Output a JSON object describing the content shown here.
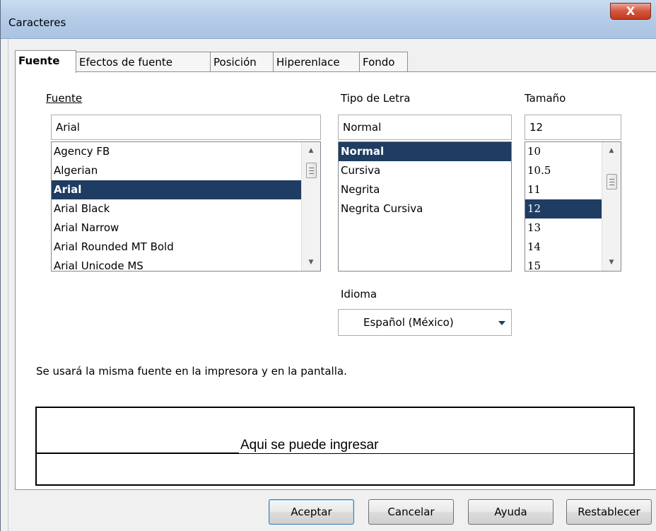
{
  "window": {
    "title": "Caracteres",
    "close_label": "X"
  },
  "tabs": [
    {
      "label": "Fuente",
      "active": true
    },
    {
      "label": "Efectos de fuente",
      "active": false
    },
    {
      "label": "Posición",
      "active": false
    },
    {
      "label": "Hiperenlace",
      "active": false
    },
    {
      "label": "Fondo",
      "active": false
    }
  ],
  "font": {
    "label": "Fuente",
    "value": "Arial",
    "items": [
      "Agency FB",
      "Algerian",
      "Arial",
      "Arial Black",
      "Arial Narrow",
      "Arial Rounded MT Bold",
      "Arial Unicode MS"
    ],
    "selected": "Arial"
  },
  "style": {
    "label": "Tipo de Letra",
    "value": "Normal",
    "items": [
      "Normal",
      "Cursiva",
      "Negrita",
      "Negrita Cursiva"
    ],
    "selected": "Normal"
  },
  "size": {
    "label": "Tamaño",
    "value": "12",
    "items": [
      "10",
      "10.5",
      "11",
      "12",
      "13",
      "14",
      "15"
    ],
    "selected": "12"
  },
  "language": {
    "label": "Idioma",
    "value": "Español (México)"
  },
  "note": "Se usará la misma fuente en la impresora y en la pantalla.",
  "preview": {
    "text": "Aqui se puede ingresar"
  },
  "buttons": {
    "ok": "Aceptar",
    "cancel": "Cancelar",
    "help": "Ayuda",
    "reset": "Restablecer"
  },
  "colors": {
    "selection": "#1f3d63",
    "titlebar": "#b6cde8",
    "close": "#c1391f"
  }
}
